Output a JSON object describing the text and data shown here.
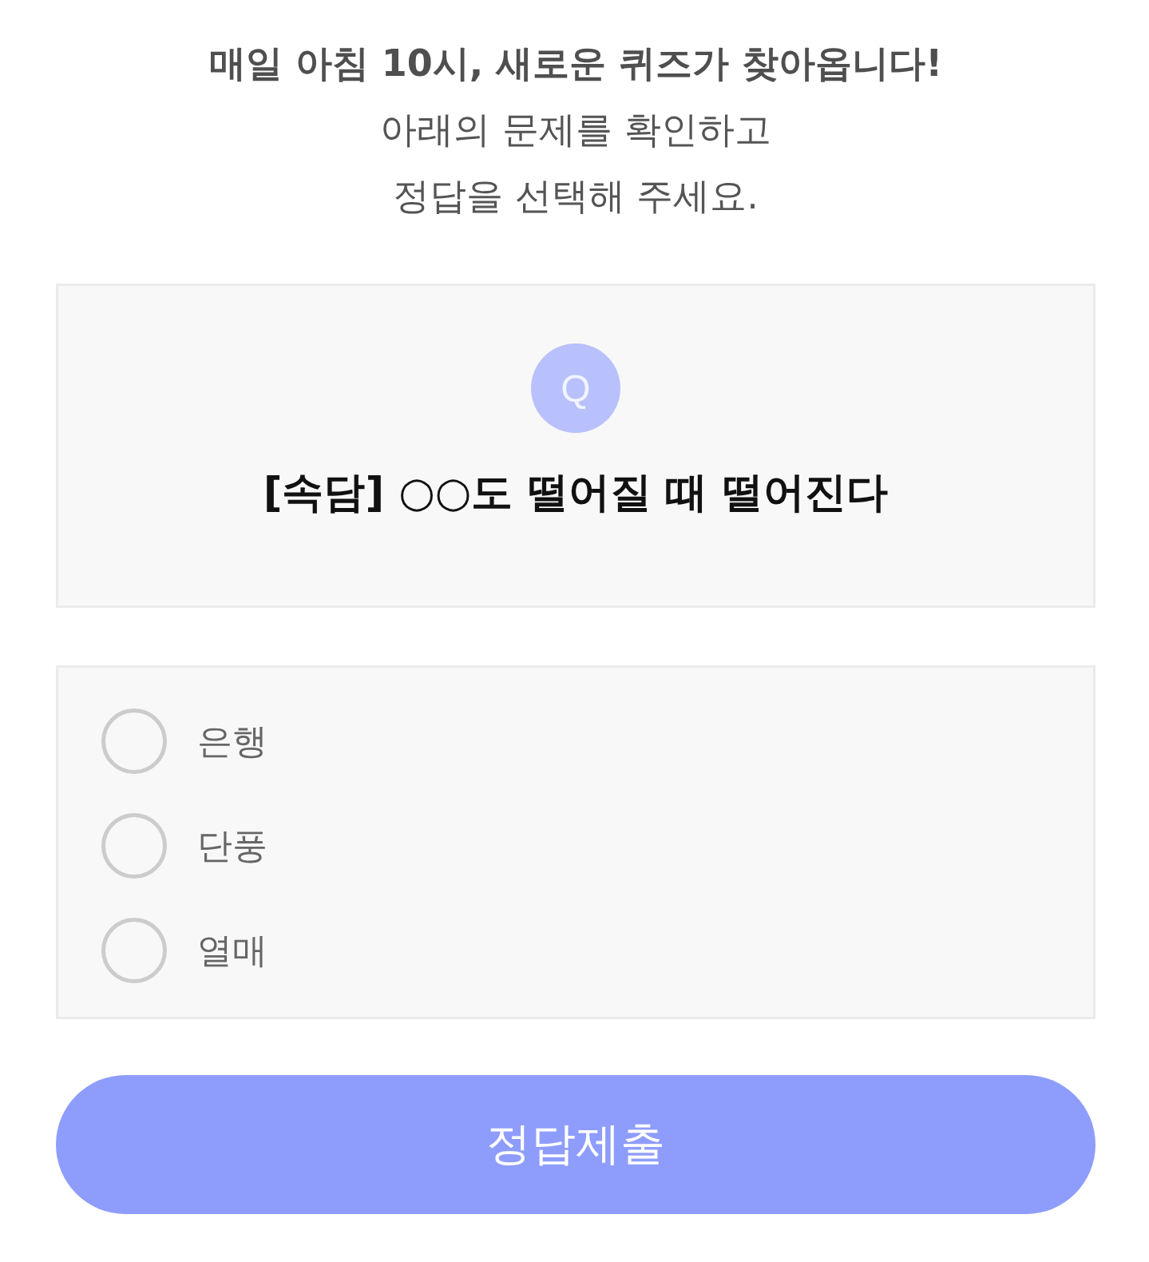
{
  "intro": {
    "headline": "매일 아침 10시, 새로운 퀴즈가 찾아옵니다!",
    "lines": [
      "아래의 문제를 확인하고",
      "정답을 선택해 주세요."
    ]
  },
  "question": {
    "badge": "Q",
    "text": "[속담] ○○도 떨어질 때 떨어진다"
  },
  "options": [
    {
      "label": "은행",
      "selected": false
    },
    {
      "label": "단풍",
      "selected": false
    },
    {
      "label": "열매",
      "selected": false
    }
  ],
  "submit_button": {
    "label": "정답제출"
  }
}
